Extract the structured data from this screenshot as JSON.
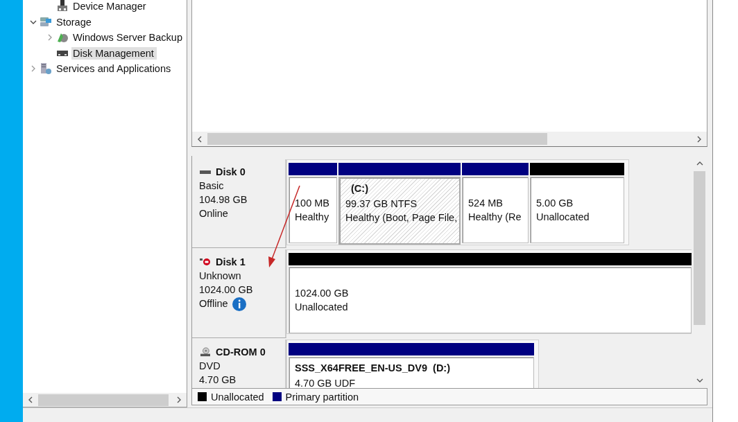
{
  "tree": {
    "continued_items": [
      {
        "label": "Device Manager",
        "kind": "device-manager",
        "selected": false
      }
    ],
    "items": [
      {
        "label": "Storage",
        "kind": "storage",
        "selected": false,
        "expanded": true,
        "children": [
          {
            "label": "Windows Server Backup",
            "kind": "backup",
            "selected": false,
            "expanded": false
          },
          {
            "label": "Disk Management",
            "kind": "disk",
            "selected": true
          }
        ]
      },
      {
        "label": "Services and Applications",
        "kind": "services",
        "selected": false,
        "expanded": false
      }
    ]
  },
  "disks": [
    {
      "name": "Disk 0",
      "kind": "disk",
      "lines": [
        "Basic",
        "104.98 GB",
        "Online"
      ],
      "partitions": [
        {
          "kind": "primary",
          "selected": false,
          "lines": [
            "100 MB",
            "Healthy"
          ]
        },
        {
          "kind": "primary",
          "selected": true,
          "title": "(C:)",
          "lines": [
            "99.37 GB NTFS",
            "Healthy (Boot, Page File,"
          ]
        },
        {
          "kind": "primary",
          "selected": false,
          "lines": [
            "524 MB",
            "Healthy (Re"
          ]
        },
        {
          "kind": "unallocated",
          "selected": false,
          "lines": [
            "5.00 GB",
            "Unallocated"
          ]
        }
      ]
    },
    {
      "name": "Disk 1",
      "kind": "offline-disk",
      "lines": [
        "Unknown",
        "1024.00 GB",
        "Offline"
      ],
      "info_icon": true,
      "partitions": [
        {
          "kind": "unallocated",
          "selected": false,
          "lines": [
            "1024.00 GB",
            "Unallocated"
          ]
        }
      ]
    },
    {
      "name": "CD-ROM 0",
      "kind": "cdrom",
      "lines": [
        "DVD",
        "4.70 GB"
      ],
      "partitions": [
        {
          "kind": "primary",
          "selected": false,
          "title": "SSS_X64FREE_EN-US_DV9  (D:)",
          "lines": [
            "4.70 GB UDF"
          ]
        }
      ]
    }
  ],
  "legend": [
    {
      "label": "Unallocated",
      "color": "#000000"
    },
    {
      "label": "Primary partition",
      "color": "#000080"
    }
  ]
}
